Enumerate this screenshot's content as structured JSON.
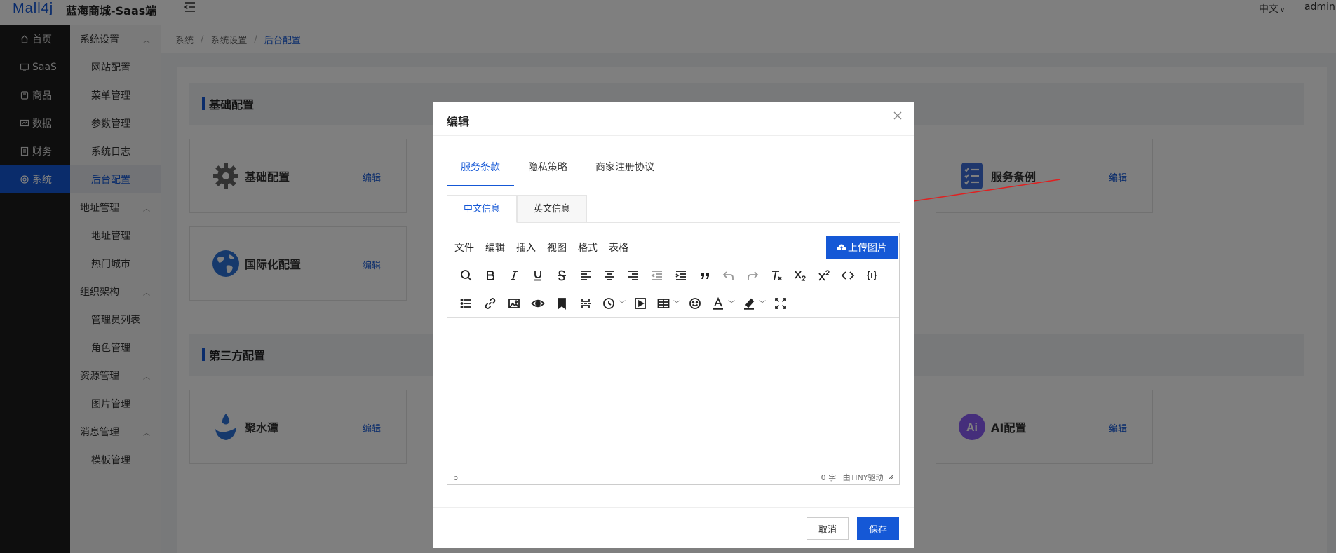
{
  "header": {
    "logo": "Mall4j",
    "brand": "蓝海商城-Saas端",
    "lang": "中文",
    "user": "admin"
  },
  "main_nav": [
    {
      "label": "首页",
      "icon": "home-icon"
    },
    {
      "label": "SaaS",
      "icon": "monitor-icon"
    },
    {
      "label": "商品",
      "icon": "product-icon"
    },
    {
      "label": "数据",
      "icon": "data-icon"
    },
    {
      "label": "财务",
      "icon": "finance-icon"
    },
    {
      "label": "系统",
      "icon": "settings-icon",
      "active": true
    }
  ],
  "sub_nav": {
    "system_settings": {
      "label": "系统设置",
      "items": [
        "网站配置",
        "菜单管理",
        "参数管理",
        "系统日志",
        "后台配置"
      ]
    },
    "address": {
      "label": "地址管理",
      "items": [
        "地址管理",
        "热门城市"
      ]
    },
    "org": {
      "label": "组织架构",
      "items": [
        "管理员列表",
        "角色管理"
      ]
    },
    "resource": {
      "label": "资源管理",
      "items": [
        "图片管理"
      ]
    },
    "message": {
      "label": "消息管理",
      "items": [
        "模板管理"
      ]
    }
  },
  "breadcrumb": [
    "系统",
    "系统设置",
    "后台配置"
  ],
  "sections": {
    "basic": {
      "title": "基础配置",
      "cards": [
        {
          "title": "基础配置",
          "edit": "编辑",
          "icon": "gear-icon"
        },
        {
          "title": "服务条例",
          "edit": "编辑",
          "icon": "checklist-icon"
        },
        {
          "title": "国际化配置",
          "edit": "编辑",
          "icon": "globe-icon"
        }
      ]
    },
    "third": {
      "title": "第三方配置",
      "cards": [
        {
          "title": "聚水潭",
          "edit": "编辑",
          "icon": "water-drop-icon"
        },
        {
          "title": "AI配置",
          "edit": "编辑",
          "icon": "ai-icon"
        }
      ]
    }
  },
  "modal": {
    "title": "编辑",
    "tabs": [
      "服务条款",
      "隐私策略",
      "商家注册协议"
    ],
    "active_tab": "服务条款",
    "subtabs": [
      "中文信息",
      "英文信息"
    ],
    "active_subtab": "中文信息",
    "editor": {
      "menus": [
        "文件",
        "编辑",
        "插入",
        "视图",
        "格式",
        "表格"
      ],
      "upload_label": "上传图片",
      "path": "p",
      "word_count": "0 字",
      "powered_by": "由TINY驱动"
    },
    "cancel": "取消",
    "save": "保存"
  },
  "colors": {
    "accent": "#1558d6",
    "sidebar_dark": "#1d1d1d",
    "annotation_arrow": "#e02020"
  }
}
